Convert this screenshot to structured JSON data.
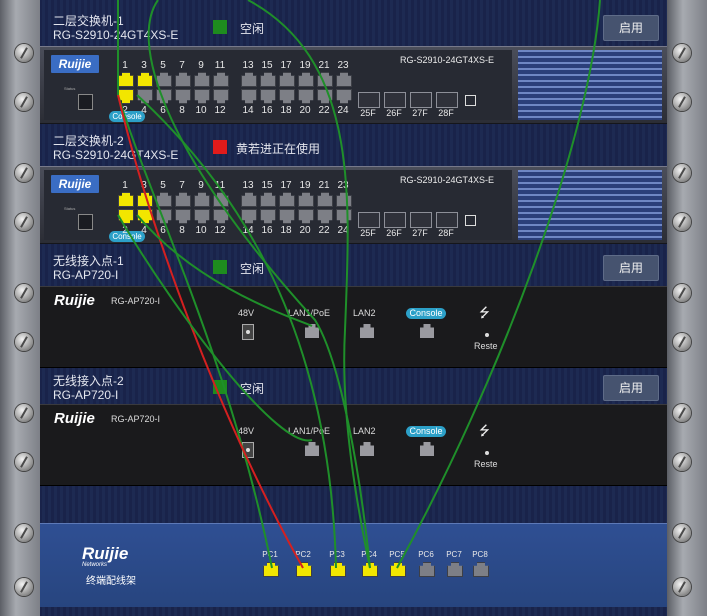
{
  "brand": "Ruijie",
  "devices": [
    {
      "name": "二层交换机-1",
      "model": "RG-S2910-24GT4XS-E",
      "status_color": "#1e8c1e",
      "status_text": "空闲",
      "action_label": "启用",
      "face_model": "RG-S2910-24GT4XS-E",
      "console_label": "Console",
      "odd_ports": [
        "1",
        "3",
        "5",
        "7",
        "9",
        "11",
        "13",
        "15",
        "17",
        "19",
        "21",
        "23"
      ],
      "even_ports": [
        "2",
        "4",
        "6",
        "8",
        "10",
        "12",
        "14",
        "16",
        "18",
        "20",
        "22",
        "24"
      ],
      "active_ports": [
        "1",
        "2",
        "3"
      ],
      "sfp_ports": [
        "25F",
        "26F",
        "27F",
        "28F"
      ]
    },
    {
      "name": "二层交换机-2",
      "model": "RG-S2910-24GT4XS-E",
      "status_color": "#e01b1b",
      "status_text": "黄若进正在使用",
      "action_label": "",
      "face_model": "RG-S2910-24GT4XS-E",
      "console_label": "Console",
      "odd_ports": [
        "1",
        "3",
        "5",
        "7",
        "9",
        "11",
        "13",
        "15",
        "17",
        "19",
        "21",
        "23"
      ],
      "even_ports": [
        "2",
        "4",
        "6",
        "8",
        "10",
        "12",
        "14",
        "16",
        "18",
        "20",
        "22",
        "24"
      ],
      "active_ports": [
        "1",
        "2",
        "3",
        "4"
      ],
      "sfp_ports": [
        "25F",
        "26F",
        "27F",
        "28F"
      ]
    },
    {
      "name": "无线接入点-1",
      "model": "RG-AP720-I",
      "status_color": "#1e8c1e",
      "status_text": "空闲",
      "action_label": "启用",
      "face_model": "RG-AP720-I",
      "port_labels": {
        "power": "48V",
        "lan1": "LAN1/PoE",
        "lan2": "LAN2",
        "console": "Console",
        "reset": "Reste"
      }
    },
    {
      "name": "无线接入点-2",
      "model": "RG-AP720-I",
      "status_color": "#1e8c1e",
      "status_text": "空闲",
      "action_label": "启用",
      "face_model": "RG-AP720-I",
      "port_labels": {
        "power": "48V",
        "lan1": "LAN1/PoE",
        "lan2": "LAN2",
        "console": "Console",
        "reset": "Reste"
      }
    }
  ],
  "patch_panel": {
    "logo": "Ruijie",
    "logo_sub": "Networks",
    "label": "终端配线架",
    "ports": [
      "PC1",
      "PC2",
      "PC3",
      "PC4",
      "PC5",
      "PC6",
      "PC7",
      "PC8"
    ],
    "active_ports": [
      "PC1",
      "PC2",
      "PC3",
      "PC4",
      "PC5"
    ]
  },
  "cable_colors": {
    "green": "#1f8f2a",
    "red": "#d42020"
  }
}
